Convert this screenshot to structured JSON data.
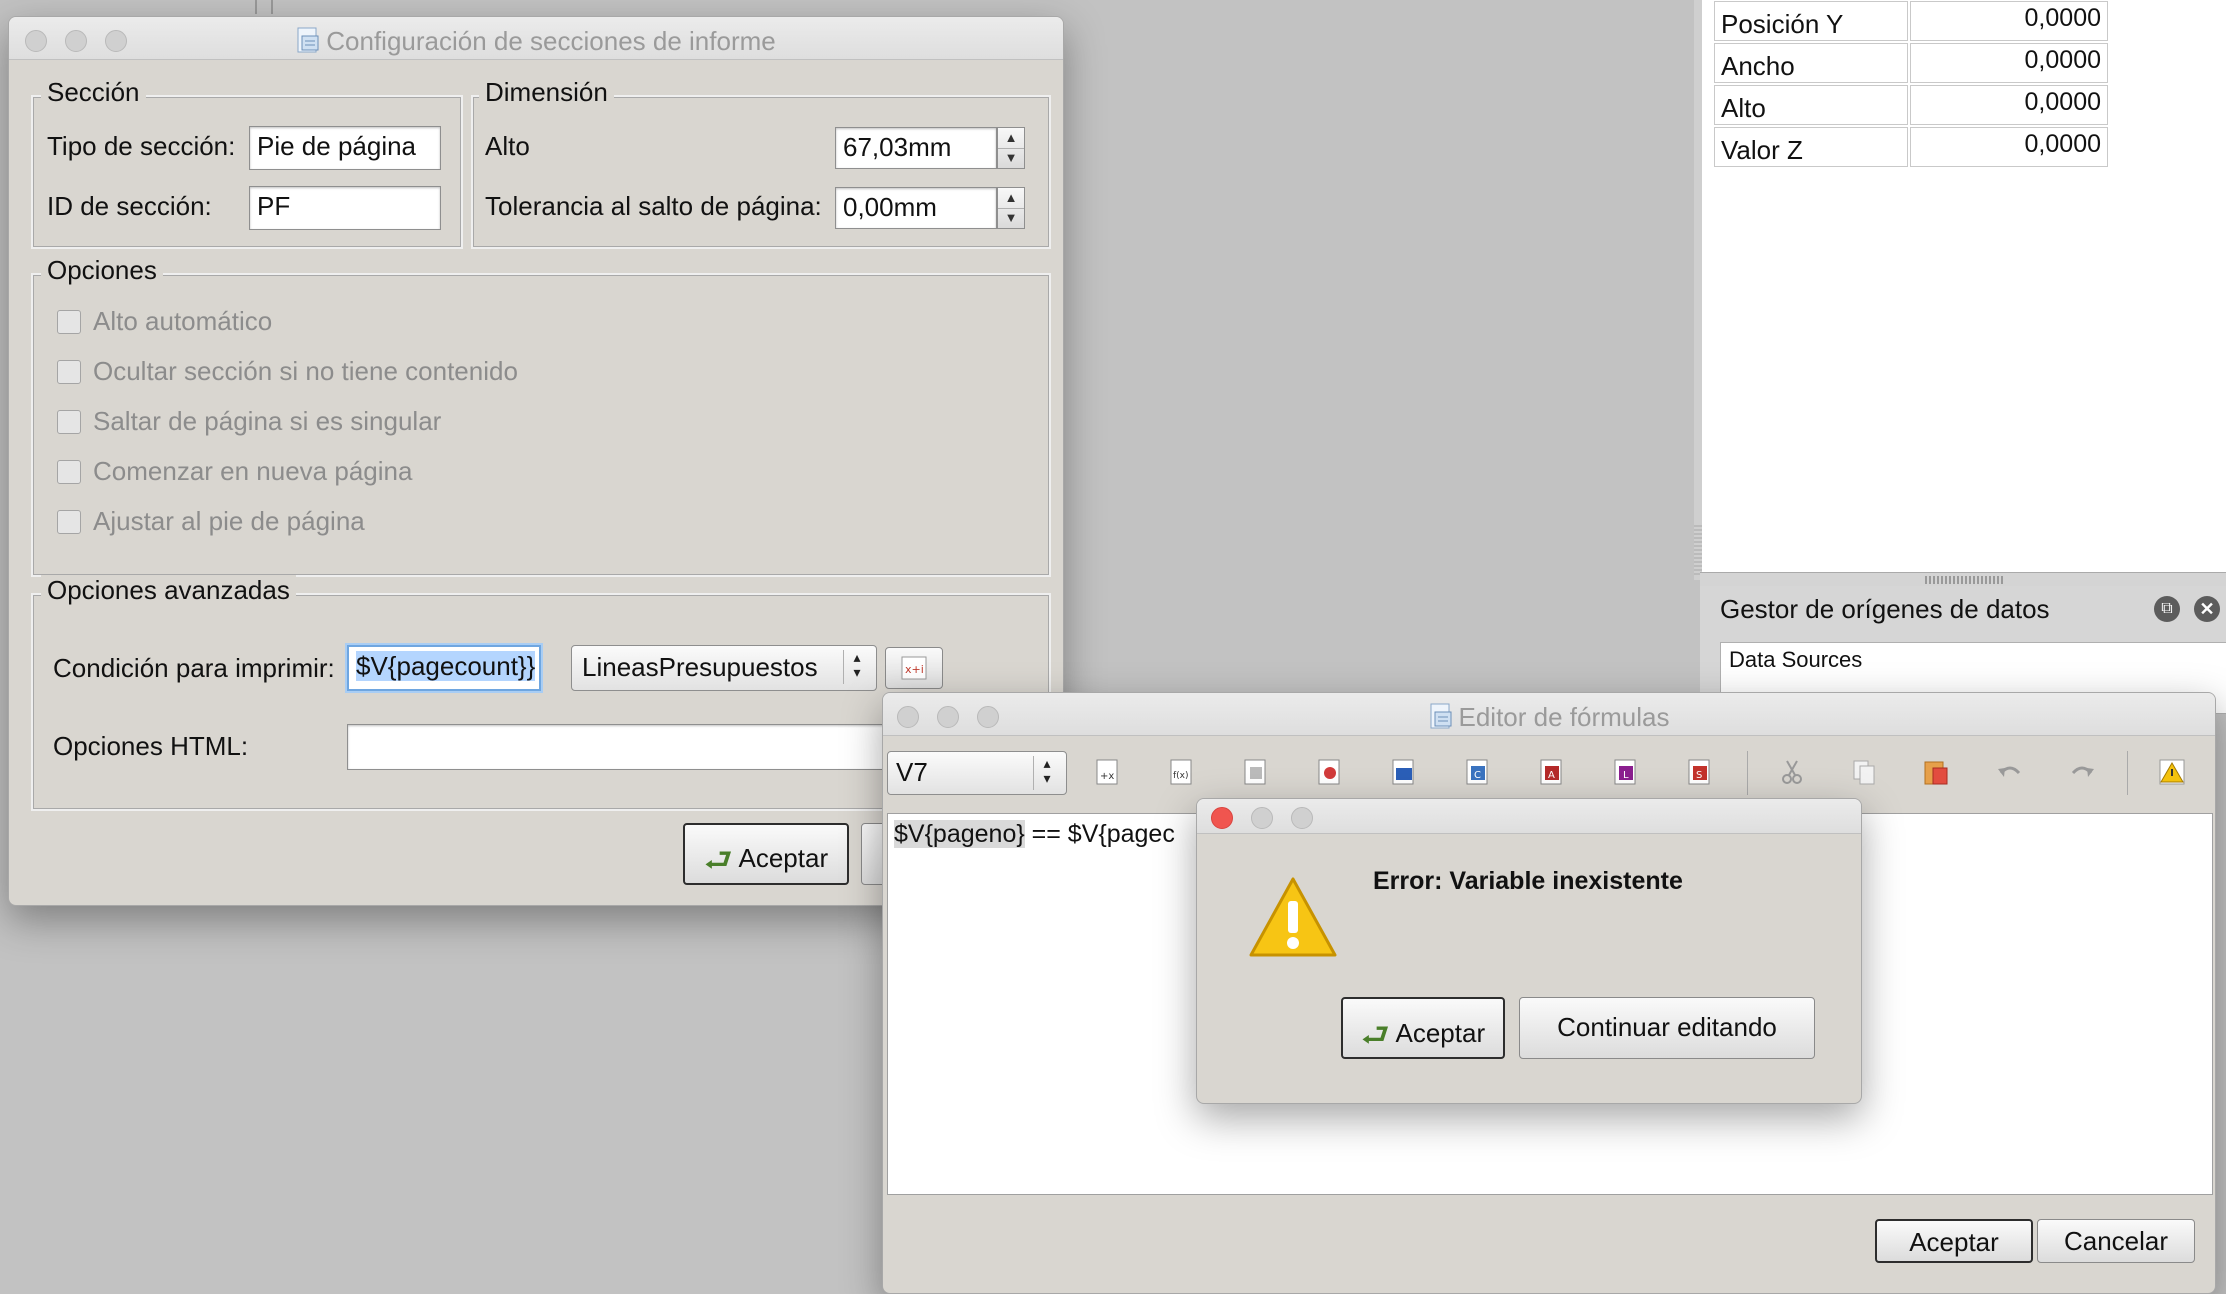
{
  "config_window": {
    "title": "Configuración de secciones de informe",
    "section_group": {
      "label": "Sección",
      "type_label": "Tipo de sección:",
      "type_value": "Pie de página",
      "id_label": "ID de sección:",
      "id_value": "PF"
    },
    "dimension_group": {
      "label": "Dimensión",
      "height_label": "Alto",
      "height_value": "67,03mm",
      "tolerance_label": "Tolerancia al salto de página:",
      "tolerance_value": "0,00mm"
    },
    "options_group": {
      "label": "Opciones",
      "items": [
        "Alto automático",
        "Ocultar sección si no tiene contenido",
        "Saltar de página si es singular",
        "Comenzar en nueva página",
        "Ajustar al pie de página"
      ]
    },
    "advanced_group": {
      "label": "Opciones avanzadas",
      "print_condition_label": "Condición para imprimir:",
      "print_condition_value": "$V{pagecount}}",
      "datasource_select": "LineasPresupuestos",
      "html_options_label": "Opciones HTML:",
      "html_options_value": ""
    },
    "accept_label": "Aceptar"
  },
  "properties_panel": {
    "rows": [
      {
        "name": "Posición Y",
        "value": "0,0000"
      },
      {
        "name": "Ancho",
        "value": "0,0000"
      },
      {
        "name": "Alto",
        "value": "0,0000"
      },
      {
        "name": "Valor Z",
        "value": "0,0000"
      }
    ]
  },
  "datasources_panel": {
    "title": "Gestor de orígenes de datos",
    "tree_header": "Data Sources"
  },
  "formula_editor": {
    "title": "Editor de fórmulas",
    "variable_select": "V7",
    "formula_text_highlight": "$V{pageno}",
    "formula_text_rest": " == $V{pagec",
    "accept_label": "Aceptar",
    "cancel_label": "Cancelar"
  },
  "error_dialog": {
    "message": "Error: Variable inexistente",
    "accept_label": "Aceptar",
    "continue_label": "Continuar editando"
  }
}
